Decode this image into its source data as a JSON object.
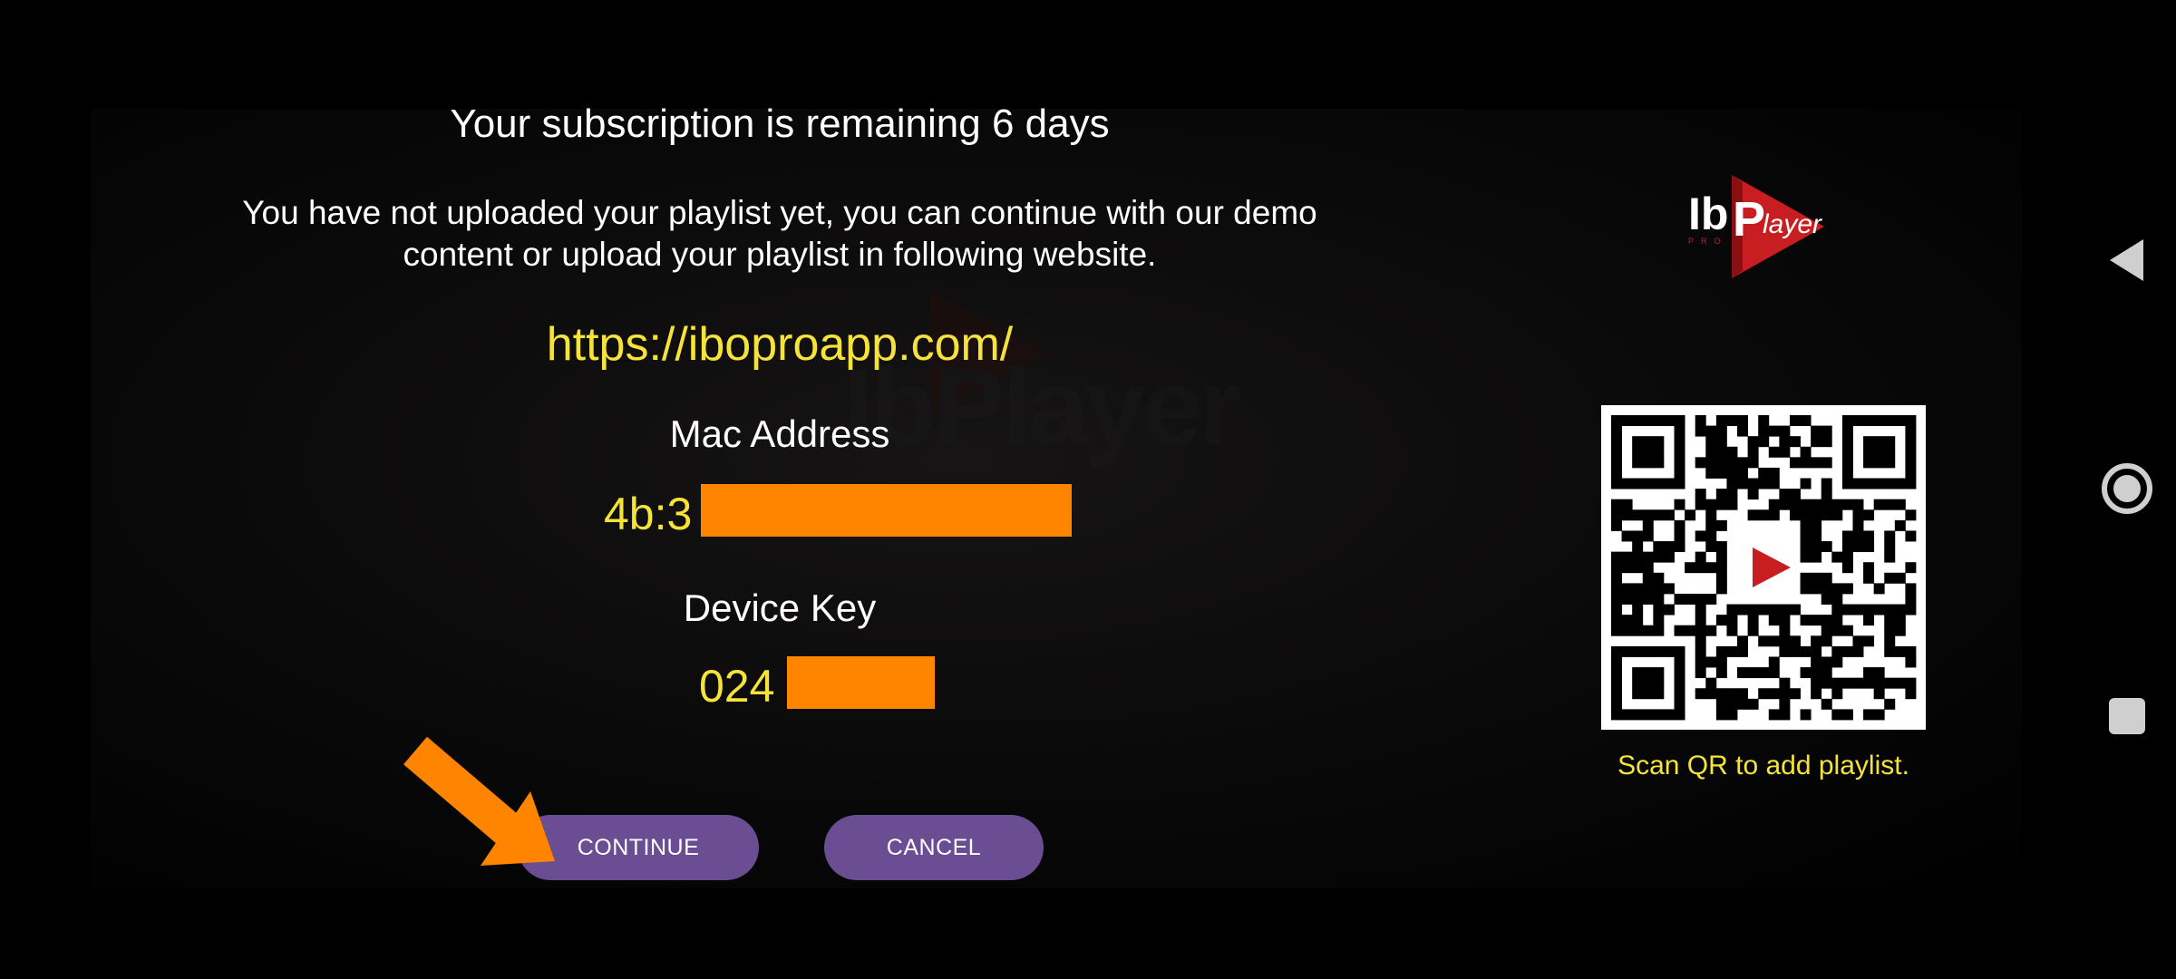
{
  "dialog": {
    "title": "Your subscription is remaining 6 days",
    "message_line1": "You have not uploaded your playlist yet, you can continue with our demo",
    "message_line2": "content or upload your playlist in following website.",
    "url": "https://iboproapp.com/",
    "mac_label": "Mac Address",
    "mac_value_visible": "4b:3",
    "device_key_label": "Device Key",
    "device_key_visible": "024",
    "continue_label": "CONTINUE",
    "cancel_label": "CANCEL"
  },
  "brand": {
    "logo_text_left": "Ib",
    "logo_text_mid": "P",
    "logo_text_right": "layer",
    "logo_sub": "PRO",
    "watermark_text": "IbPlayer"
  },
  "qr": {
    "caption": "Scan QR to add playlist."
  },
  "colors": {
    "accent_yellow": "#f6e33a",
    "button_purple": "#6a4d92",
    "redaction_orange": "#ff8400",
    "logo_red": "#c81e22"
  },
  "icons": {
    "nav_back": "back-triangle-icon",
    "nav_home": "home-circle-icon",
    "nav_recents": "recents-square-icon",
    "annotation_arrow": "orange-arrow-icon"
  }
}
